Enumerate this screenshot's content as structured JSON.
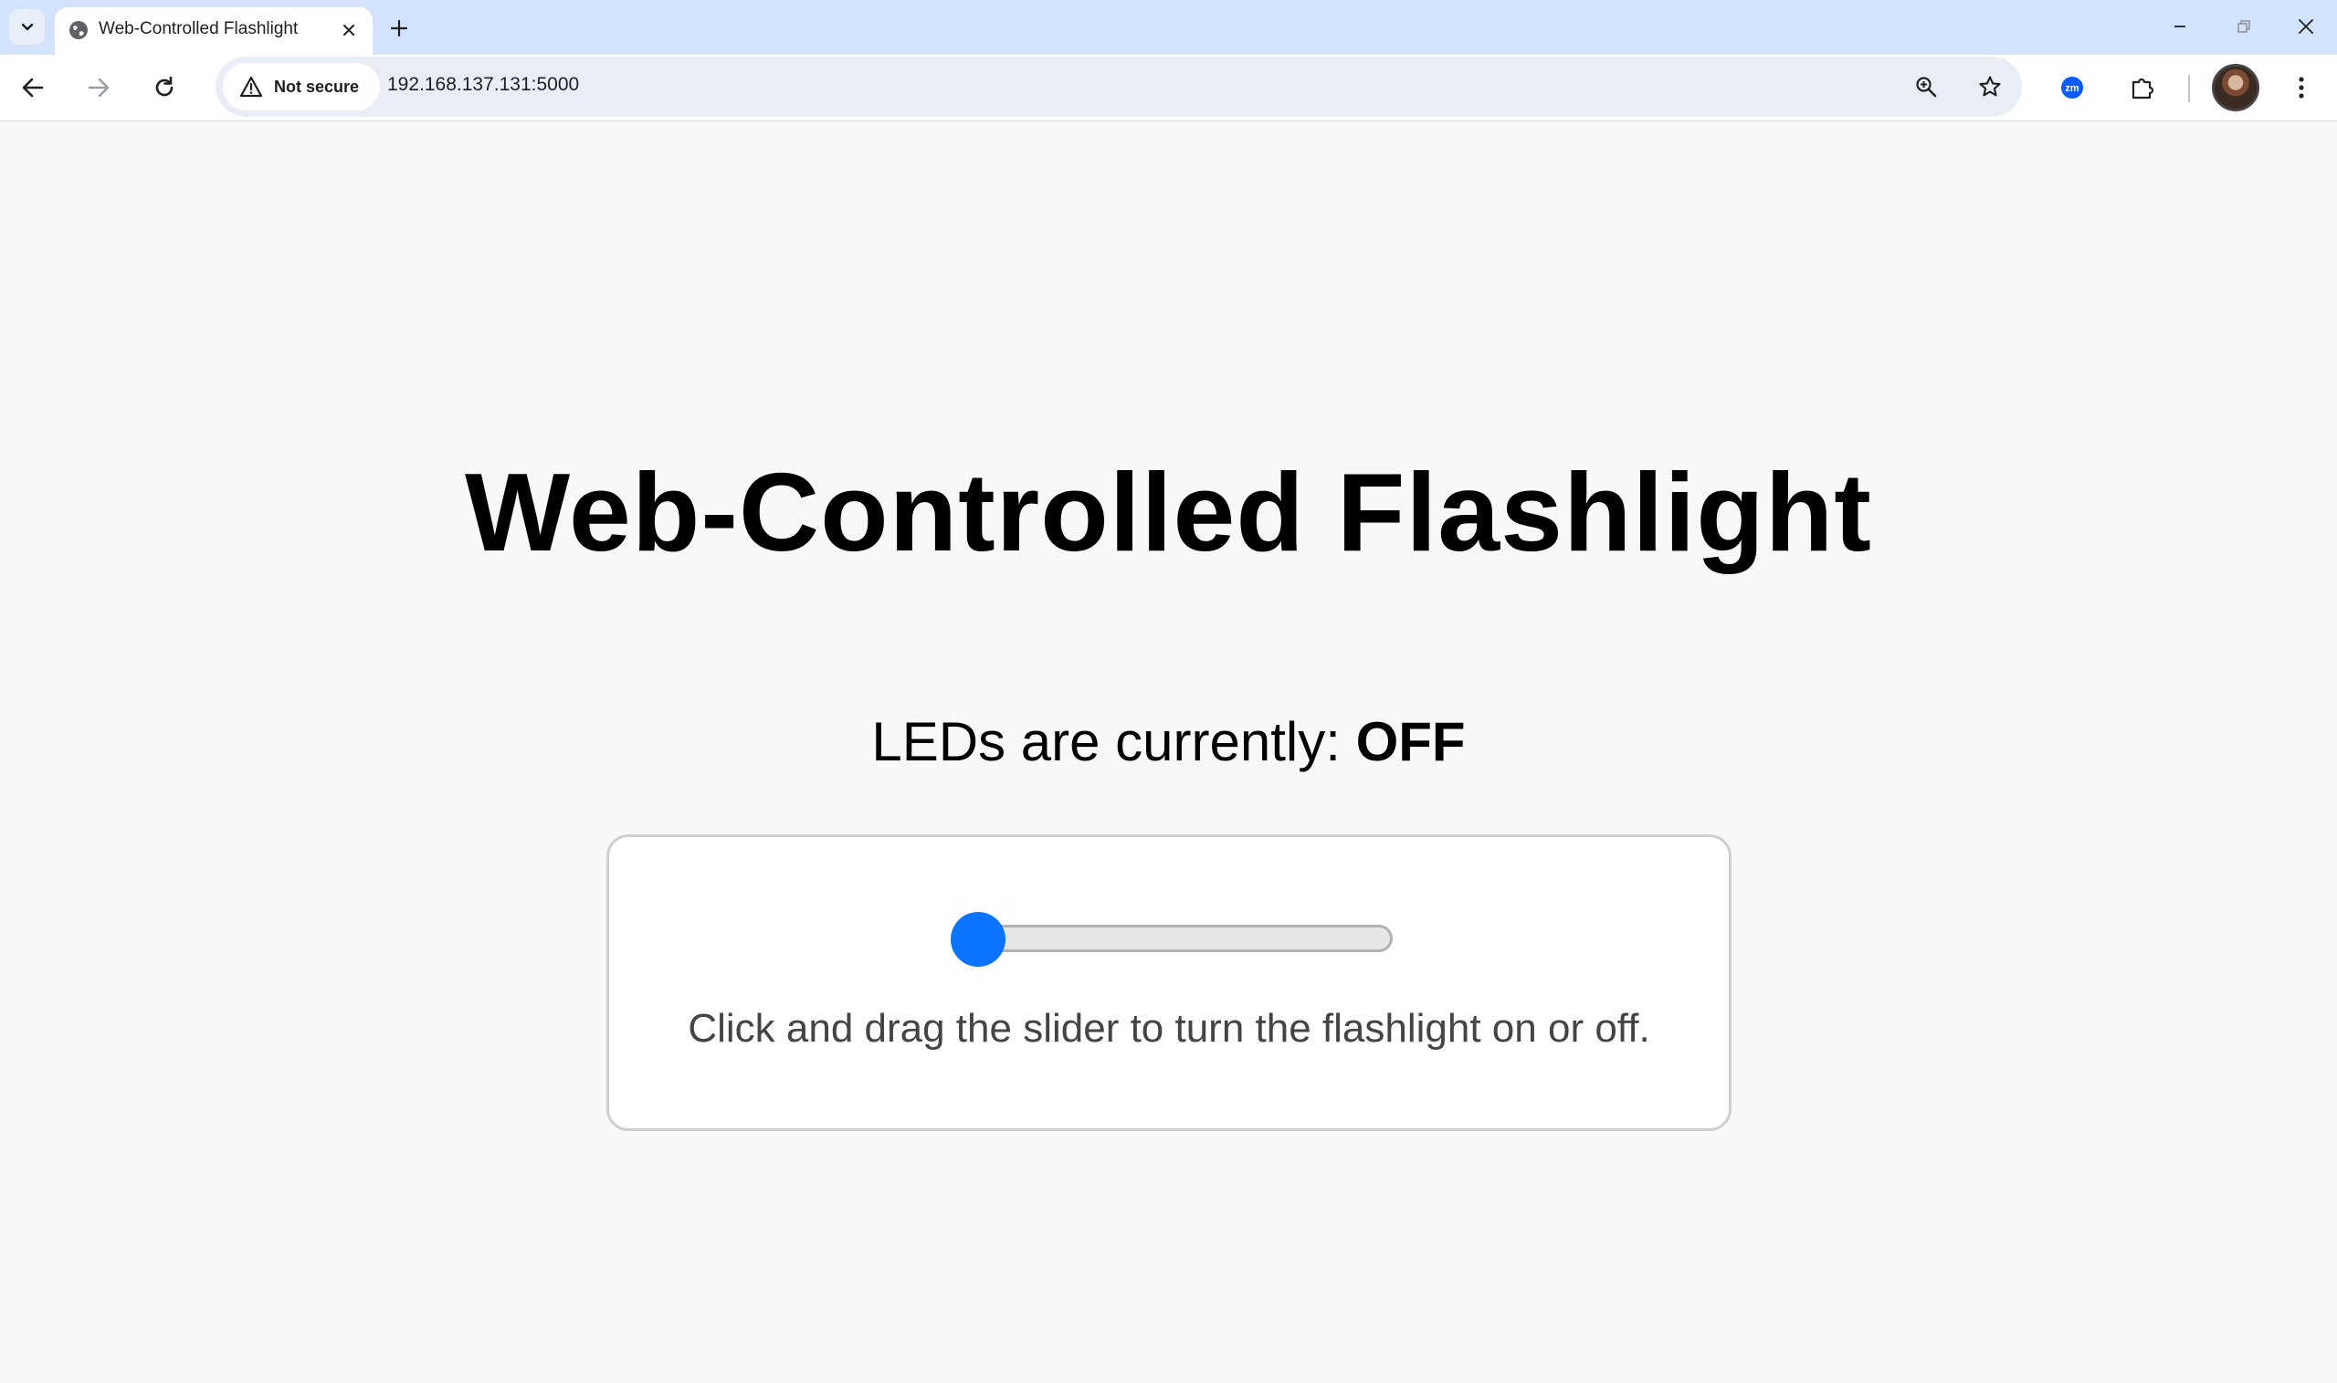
{
  "browser": {
    "tab": {
      "title": "Web-Controlled Flashlight"
    },
    "address_bar": {
      "security_label": "Not secure",
      "url": "192.168.137.131:5000"
    },
    "extension_badge": "zm"
  },
  "page": {
    "title": "Web-Controlled Flashlight",
    "status_prefix": "LEDs are currently: ",
    "status_value": "OFF",
    "hint": "Click and drag the slider to turn the flashlight on or off.",
    "slider": {
      "value": 0,
      "min": 0,
      "max": 1
    }
  },
  "colors": {
    "accent": "#0a74ff",
    "tabstrip": "#d3e3fd",
    "page_bg": "#f8f8f8"
  }
}
